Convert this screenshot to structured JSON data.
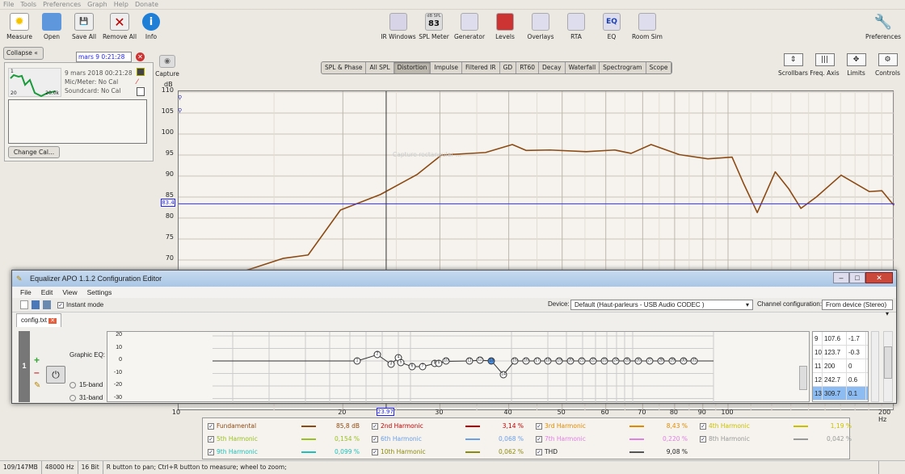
{
  "menu": [
    "File",
    "Tools",
    "Preferences",
    "Graph",
    "Help",
    "Donate"
  ],
  "toolbar_left": [
    "Measure",
    "Open",
    "Save All",
    "Remove All",
    "Info"
  ],
  "toolbar_center": [
    {
      "label": "IR Windows",
      "icon": "ir-windows-icon"
    },
    {
      "label": "SPL Meter",
      "icon": "83"
    },
    {
      "label": "Generator",
      "icon": "sine-icon"
    },
    {
      "label": "Levels",
      "icon": "levels-icon"
    },
    {
      "label": "Overlays",
      "icon": "overlays-icon"
    },
    {
      "label": "RTA",
      "icon": "rta-icon"
    },
    {
      "label": "EQ",
      "icon": "EQ"
    },
    {
      "label": "Room Sim",
      "icon": "room-sim-icon"
    }
  ],
  "spl_meter_caption": "dB SPL",
  "preferences": "Preferences",
  "graph_tabs": [
    "SPL & Phase",
    "All SPL",
    "Distortion",
    "Impulse",
    "Filtered IR",
    "GD",
    "RT60",
    "Decay",
    "Waterfall",
    "Spectrogram",
    "Scope"
  ],
  "active_tab": "Distortion",
  "graph_controls": [
    "Scrollbars",
    "Freq. Axis",
    "Limits",
    "Controls"
  ],
  "capture": "Capture",
  "capture_hint": "Capture rectangular ...",
  "left_panel": {
    "collapse": "Collapse",
    "measurement_name": "mars 9 0:21:28",
    "date": "9 mars 2018 00:21:28",
    "mic": "Mic/Meter: No Cal",
    "soundcard": "Soundcard: No Cal",
    "thumb_left": "20",
    "thumb_right": "20.0k",
    "thumb_top": "1",
    "change_cal": "Change Cal..."
  },
  "chart_data": {
    "type": "line",
    "ylabel": "dB",
    "xlabel": "Hz",
    "ylim": [
      35,
      110
    ],
    "xlim": [
      10,
      200
    ],
    "xscale": "log",
    "yticks": [
      110,
      105,
      100,
      95,
      90,
      85,
      80,
      75,
      70
    ],
    "xticks": [
      "10",
      "20",
      "30",
      "40",
      "50",
      "60",
      "70",
      "80",
      "90",
      "100",
      "200 Hz"
    ],
    "cursor": {
      "y": "83.4",
      "x": "23.97"
    },
    "series": [
      {
        "name": "Fundamental",
        "color": "#8b4a14",
        "x": [
          10,
          13.2,
          15.6,
          17.3,
          19.8,
          23.4,
          27.3,
          30.2,
          36.3,
          40.6,
          43.0,
          47.5,
          55.3,
          62.3,
          66.7,
          72.5,
          81.6,
          91.9,
          101.7,
          106.9,
          113.0,
          121.8,
          128.8,
          135.6,
          144.6,
          160.4,
          180.4,
          190.2,
          200
        ],
        "y": [
          60,
          67.3,
          70.4,
          71.2,
          81.9,
          85.6,
          90.4,
          95,
          95.6,
          97.5,
          96.1,
          96.2,
          95.8,
          96.2,
          95.4,
          97.5,
          95.1,
          94.1,
          94.5,
          88,
          81.3,
          91,
          87,
          82.3,
          85,
          90.2,
          86.3,
          86.5,
          83
        ]
      }
    ]
  },
  "legend": [
    {
      "name": "Fundamental",
      "value": "85,8 dB",
      "color": "#8b4a14"
    },
    {
      "name": "2nd Harmonic",
      "value": "3,14 %",
      "color": "#c00000"
    },
    {
      "name": "3rd Harmonic",
      "value": "8,43 %",
      "color": "#e08a00"
    },
    {
      "name": "4th Harmonic",
      "value": "1,19 %",
      "color": "#c8c000"
    },
    {
      "name": "5th Harmonic",
      "value": "0,154 %",
      "color": "#98c020"
    },
    {
      "name": "6th Harmonic",
      "value": "0,068 %",
      "color": "#6b9fe8"
    },
    {
      "name": "7th Harmonic",
      "value": "0,220 %",
      "color": "#e080e0"
    },
    {
      "name": "8th Harmonic",
      "value": "0,042 %",
      "color": "#999999"
    },
    {
      "name": "9th Harmonic",
      "value": "0,099 %",
      "color": "#20c0b8"
    },
    {
      "name": "10th Harmonic",
      "value": "0,062 %",
      "color": "#8a8a10"
    },
    {
      "name": "THD",
      "value": "9,08 %",
      "color": "#555555"
    }
  ],
  "status": [
    "109/147MB",
    "48000 Hz",
    "16 Bit",
    "R button to pan; Ctrl+R button to measure; wheel to zoom;"
  ],
  "eq": {
    "title": "Equalizer APO 1.1.2 Configuration Editor",
    "menu": [
      "File",
      "Edit",
      "View",
      "Settings"
    ],
    "instant_mode": "Instant mode",
    "device_label": "Device:",
    "device": "Default (Haut-parleurs - USB Audio CODEC )",
    "channel_label": "Channel configuration:",
    "channel": "From device (Stereo)",
    "file_tab": "config.txt",
    "filter_index": "1",
    "filter_label": "Graphic EQ:",
    "band_options": [
      "15-band",
      "31-band"
    ],
    "y_ticks": [
      "20",
      "10",
      "0",
      "-10",
      "-20",
      "-30"
    ],
    "band_gains": [
      0,
      5,
      -2.6,
      2.6,
      -1.3,
      -4.5,
      -4.5,
      -2,
      -1.7,
      -0.3,
      0,
      0.6,
      0.1,
      -11,
      0,
      0,
      0,
      0,
      0,
      0,
      0,
      0,
      0,
      0,
      0,
      0,
      0,
      0,
      0,
      0,
      0
    ],
    "selected_band": 13,
    "table": [
      [
        "9",
        "107.6",
        "-1.7"
      ],
      [
        "10",
        "123.7",
        "-0.3"
      ],
      [
        "11",
        "200",
        "0"
      ],
      [
        "12",
        "242.7",
        "0.6"
      ],
      [
        "13",
        "309.7",
        "0.1"
      ]
    ]
  }
}
